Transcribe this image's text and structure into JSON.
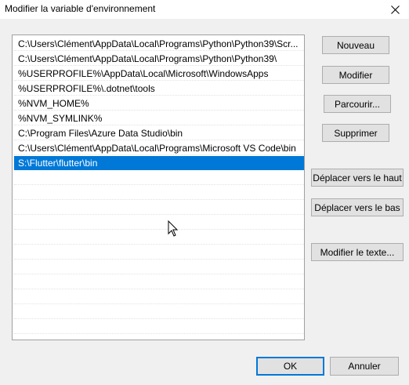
{
  "window": {
    "title": "Modifier la variable d'environnement"
  },
  "icons": {
    "close": "close-icon",
    "pointer": "mouse-pointer-icon"
  },
  "list": {
    "items": [
      "C:\\Users\\Clément\\AppData\\Local\\Programs\\Python\\Python39\\Scr...",
      "C:\\Users\\Clément\\AppData\\Local\\Programs\\Python\\Python39\\",
      "%USERPROFILE%\\AppData\\Local\\Microsoft\\WindowsApps",
      "%USERPROFILE%\\.dotnet\\tools",
      "%NVM_HOME%",
      "%NVM_SYMLINK%",
      "C:\\Program Files\\Azure Data Studio\\bin",
      "C:\\Users\\Clément\\AppData\\Local\\Programs\\Microsoft VS Code\\bin",
      "S:\\Flutter\\flutter\\bin",
      "",
      "",
      "",
      "",
      "",
      "",
      "",
      "",
      "",
      "",
      ""
    ],
    "selected_index": 8
  },
  "buttons": {
    "new": "Nouveau",
    "edit": "Modifier",
    "browse": "Parcourir...",
    "delete": "Supprimer",
    "move_up": "Déplacer vers le haut",
    "move_down": "Déplacer vers le bas",
    "edit_text": "Modifier le texte...",
    "ok": "OK",
    "cancel": "Annuler"
  },
  "colors": {
    "selection": "#0078d7",
    "default_button_border": "#0078d7"
  }
}
